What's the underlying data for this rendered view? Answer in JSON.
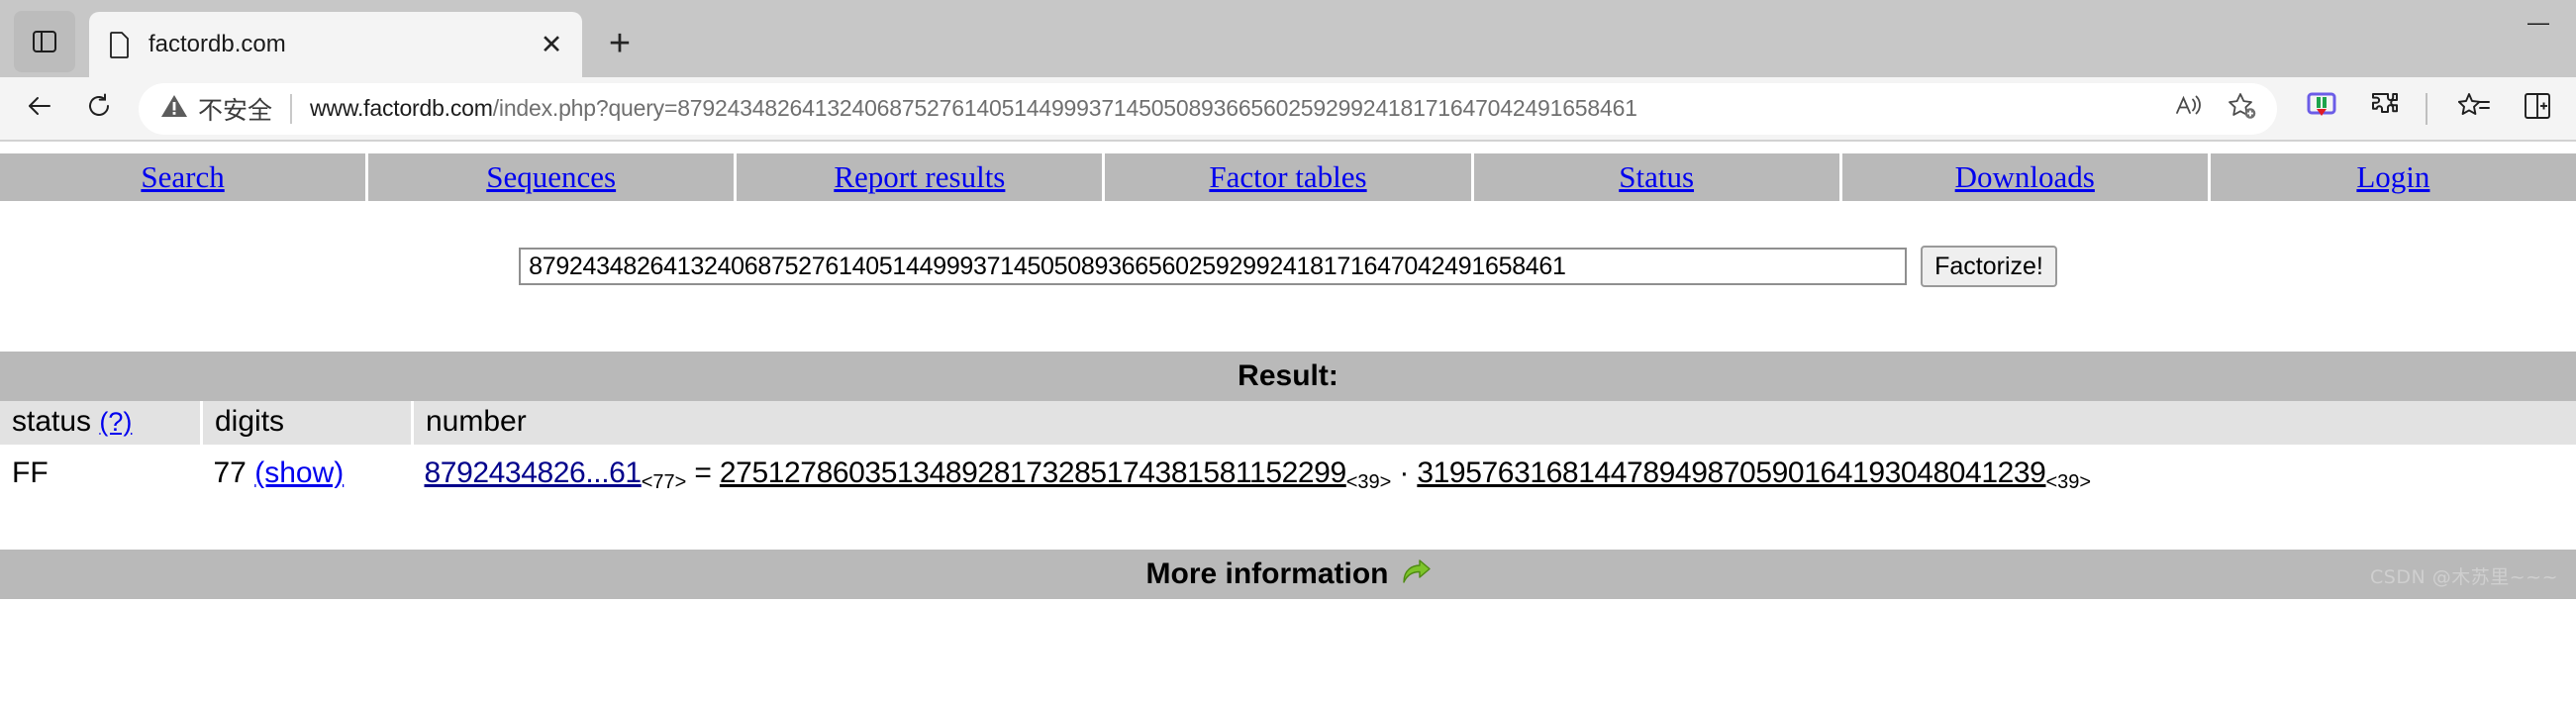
{
  "browser": {
    "tab": {
      "title": "factordb.com",
      "favicon": "page-icon",
      "close_label": "✕"
    },
    "new_tab_label": "+",
    "sidebar_toggle": "sidebar-icon",
    "window_controls": {
      "minimize": "—"
    },
    "nav": {
      "back_label": "←",
      "reload_label": "↻"
    },
    "omnibox": {
      "security_text": "不安全",
      "security_icon": "warning-triangle-icon",
      "url_host": "www.factordb.com",
      "url_path": "/index.php?query=87924348264132406875276140514499937145050893665602592992418171647042491658461",
      "read_aloud_icon": "read-aloud-icon",
      "add_favorite_icon": "add-favorite-star-icon"
    },
    "toolbar_icons": [
      "extension-colorful-icon",
      "extensions-puzzle-icon",
      "collections-icon",
      "split-screen-icon"
    ]
  },
  "site": {
    "menu": [
      {
        "label": "Search"
      },
      {
        "label": "Sequences"
      },
      {
        "label": "Report results"
      },
      {
        "label": "Factor tables"
      },
      {
        "label": "Status"
      },
      {
        "label": "Downloads"
      },
      {
        "label": "Login"
      }
    ],
    "search": {
      "value": "87924348264132406875276140514499937145050893665602592992418171647042491658461",
      "placeholder": "",
      "submit_label": "Factorize!"
    },
    "result": {
      "heading": "Result:",
      "columns": {
        "status": "status",
        "status_help": "(?)",
        "digits": "digits",
        "number": "number"
      },
      "row": {
        "status": "FF",
        "digits": "77",
        "show_label": "(show)",
        "number_display": "8792434826...61",
        "number_digit_count": "<77>",
        "equals": "=",
        "multiply": "·",
        "factors": [
          {
            "value": "275127860351348928173285174381581152299",
            "digit_count": "<39>"
          },
          {
            "value": "319576316814478949870590164193048041239",
            "digit_count": "<39>"
          }
        ]
      }
    },
    "more_information": {
      "label": "More information",
      "icon": "green-forward-arrow-icon"
    }
  },
  "watermark": {
    "text": "CSDN @木苏里~~~"
  },
  "colors": {
    "chrome_bg": "#c7c7c7",
    "toolbar_bg": "#f4f4f4",
    "bar_gray": "#b9b9b9",
    "header_gray": "#e2e2e2",
    "link_blue": "#0000ee",
    "number_navy": "#00008b"
  }
}
